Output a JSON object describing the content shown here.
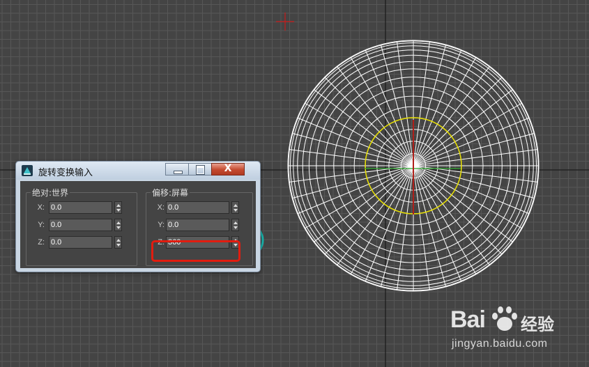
{
  "dialog": {
    "title": "旋转变换输入",
    "close_glyph": "X",
    "absolute_group": {
      "label": "绝对:世界",
      "fields": [
        {
          "axis": "X:",
          "value": "0.0"
        },
        {
          "axis": "Y:",
          "value": "0.0"
        },
        {
          "axis": "Z:",
          "value": "0.0"
        }
      ]
    },
    "offset_group": {
      "label": "偏移:屏幕",
      "fields": [
        {
          "axis": "X:",
          "value": "0.0"
        },
        {
          "axis": "Y:",
          "value": "0.0"
        },
        {
          "axis": "Z:",
          "value": "360"
        }
      ]
    }
  },
  "watermark": {
    "logo_text": "Bai",
    "brand_text": "经验",
    "url": "jingyan.baidu.com"
  },
  "colors": {
    "viewport_bg": "#444444",
    "grid": "#575757",
    "wireframe": "#ffffff",
    "gizmo_ring": "#e8e000",
    "highlight": "#e21c0f"
  }
}
